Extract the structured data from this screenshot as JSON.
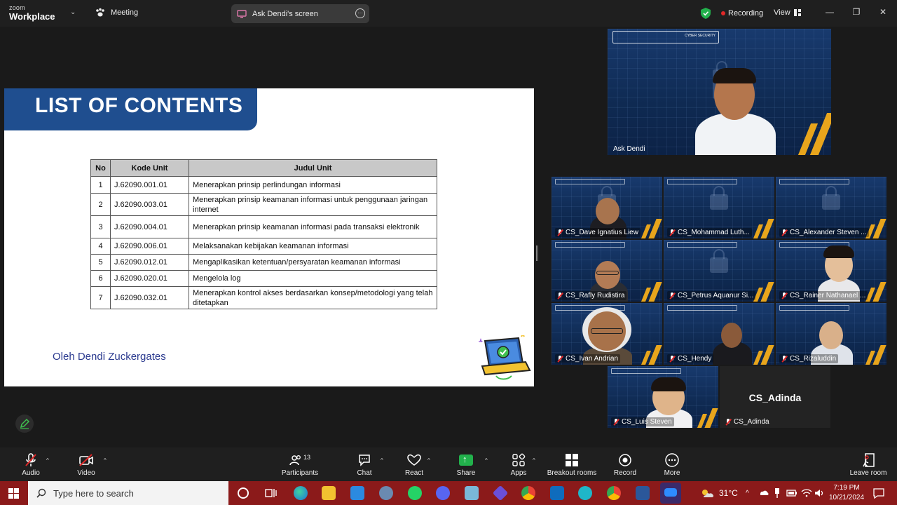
{
  "topbar": {
    "logo_line1": "zoom",
    "logo_line2": "Workplace",
    "meeting_label": "Meeting",
    "share_label": "Ask Dendi's screen",
    "recording_label": "Recording",
    "view_label": "View"
  },
  "slide": {
    "title": "LIST OF CONTENTS",
    "headers": [
      "No",
      "Kode Unit",
      "Judul Unit"
    ],
    "rows": [
      {
        "no": "1",
        "kode": "J.62090.001.01",
        "judul": "Menerapkan prinsip perlindungan informasi"
      },
      {
        "no": "2",
        "kode": "J.62090.003.01",
        "judul": "Menerapkan prinsip keamanan informasi untuk penggunaan jaringan internet"
      },
      {
        "no": "3",
        "kode": "J.62090.004.01",
        "judul": "Menerapkan prinsip keamanan informasi pada transaksi elektronik"
      },
      {
        "no": "4",
        "kode": "J.62090.006.01",
        "judul": "Melaksanakan kebijakan keamanan informasi"
      },
      {
        "no": "5",
        "kode": "J.62090.012.01",
        "judul": "Mengaplikasikan ketentuan/persyaratan keamanan informasi"
      },
      {
        "no": "6",
        "kode": "J.62090.020.01",
        "judul": "Mengelola log"
      },
      {
        "no": "7",
        "kode": "J.62090.032.01",
        "judul": "Menerapkan kontrol akses berdasarkan konsep/metodologi yang telah ditetapkan"
      }
    ],
    "author": "Oleh Dendi Zuckergates"
  },
  "speaker": {
    "name": "Ask Dendi",
    "banner_text": "CYBER SECURITY"
  },
  "participants": [
    {
      "name": "CS_Dave Ignatius Liew"
    },
    {
      "name": "CS_Mohammad Luth..."
    },
    {
      "name": "CS_Alexander Steven ..."
    },
    {
      "name": "CS_Rafly Rudistira"
    },
    {
      "name": "CS_Petrus Aquanur Si..."
    },
    {
      "name": "CS_Rainer Nathanael ..."
    },
    {
      "name": "CS_Ivan Andrian"
    },
    {
      "name": "CS_Hendy"
    },
    {
      "name": "CS_Rizaluddin"
    },
    {
      "name": "CS_Luis Steven"
    },
    {
      "name": "CS_Adinda",
      "center_label": "CS_Adinda"
    }
  ],
  "toolbar": {
    "audio": "Audio",
    "video": "Video",
    "participants": "Participants",
    "participants_count": "13",
    "chat": "Chat",
    "react": "React",
    "share": "Share",
    "apps": "Apps",
    "breakout": "Breakout rooms",
    "record": "Record",
    "more": "More",
    "leave": "Leave room"
  },
  "taskbar": {
    "search_placeholder": "Type here to search",
    "weather": "31°C",
    "time": "7:19 PM",
    "date": "10/21/2024"
  },
  "colors": {
    "slide_banner": "#1f4e8f",
    "recording_dot": "#e02828",
    "share_green": "#22b14c",
    "taskbar": "#8b1a1a",
    "accent_stripe": "#e8a51c"
  }
}
